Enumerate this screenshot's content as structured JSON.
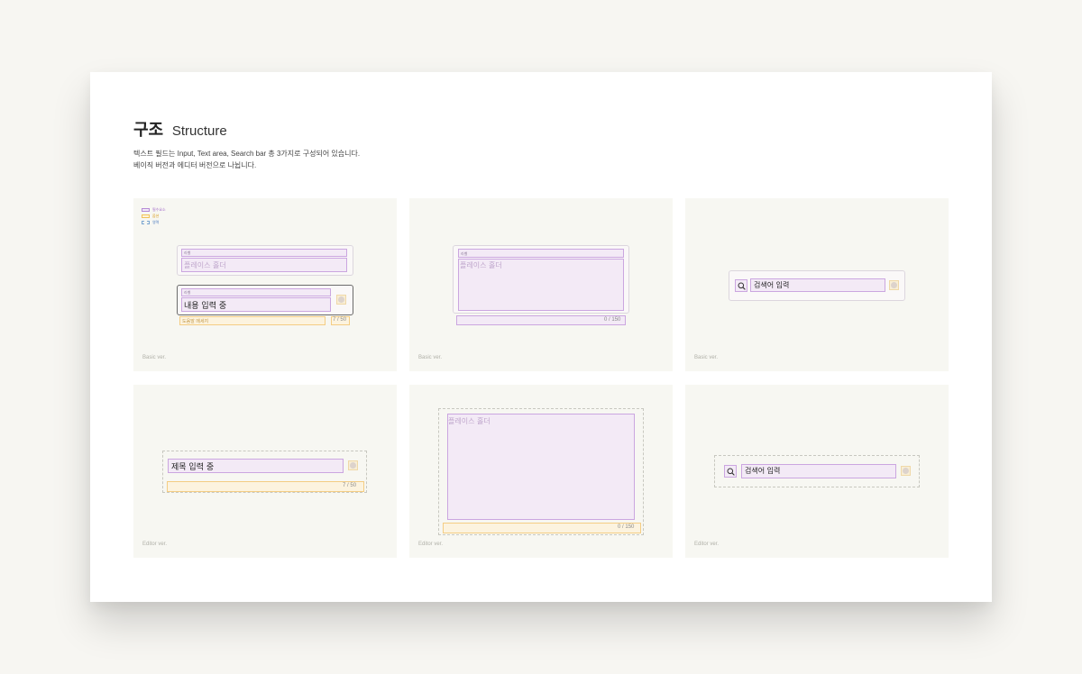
{
  "header": {
    "title_ko": "구조",
    "title_en": "Structure",
    "desc_line1": "텍스트 필드는 Input, Text area, Search bar 총 3가지로 구성되어 있습니다.",
    "desc_line2": "베이직 버전과 에디터 버전으로 나뉩니다."
  },
  "legend": {
    "required": "필수요소",
    "optional": "옵션",
    "area": "영역"
  },
  "colors": {
    "required": "#cba6e0",
    "optional": "#f4cd84",
    "area": "#c8c8c0",
    "background": "#f7f7f2"
  },
  "captions": {
    "basic": "Basic ver.",
    "editor": "Editor ver."
  },
  "input_basic": {
    "label1": "라벨",
    "placeholder": "플레이스 홀더",
    "label2": "라벨",
    "value": "내용 입력 중",
    "helper": "도움말 메세지",
    "count": "7",
    "max": "50"
  },
  "textarea_basic": {
    "label": "라벨",
    "placeholder": "플레이스 홀더",
    "count": "0",
    "max": "150"
  },
  "search_basic": {
    "value": "검색어 입력",
    "icon": "search-icon"
  },
  "input_editor": {
    "value": "제목 입력 중",
    "count": "7",
    "max": "50"
  },
  "textarea_editor": {
    "placeholder": "플레이스 홀더",
    "count": "0",
    "max": "150"
  },
  "search_editor": {
    "value": "검색어 입력",
    "icon": "search-icon"
  }
}
